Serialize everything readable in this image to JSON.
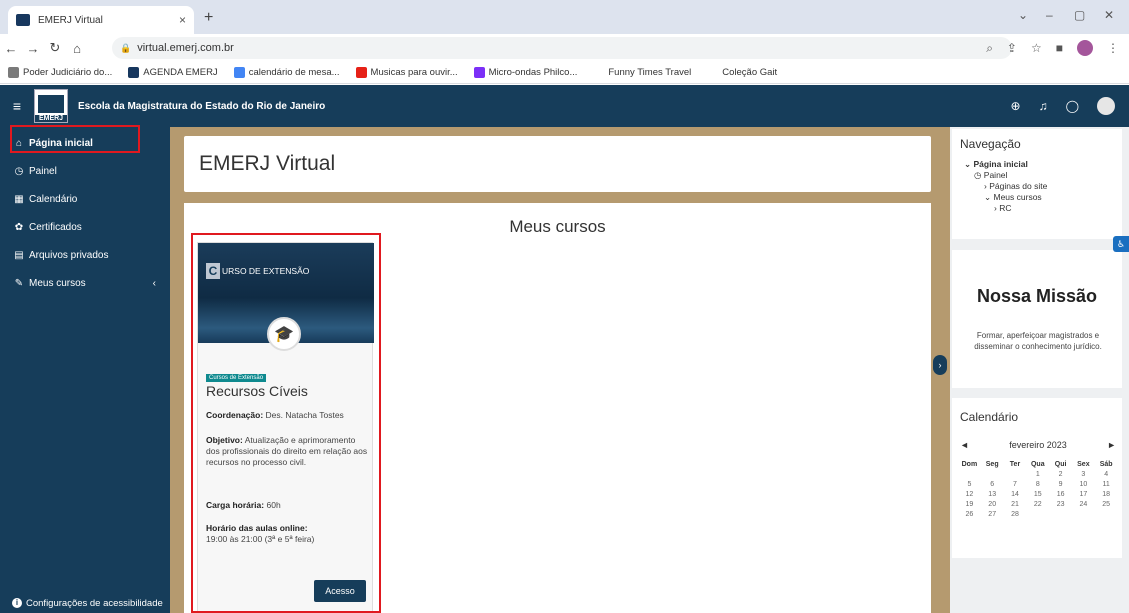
{
  "browser": {
    "tab_title": "EMERJ Virtual",
    "url": "virtual.emerj.com.br",
    "bookmarks": [
      {
        "label": "Poder Judiciário do...",
        "color": "#7a7a7a"
      },
      {
        "label": "AGENDA EMERJ",
        "color": "#17375e"
      },
      {
        "label": "calendário de mesa...",
        "color": "#4285f4"
      },
      {
        "label": "Musicas para ouvir...",
        "color": "#e62117"
      },
      {
        "label": "Micro-ondas Philco...",
        "color": "#7b2ff7"
      },
      {
        "label": "Funny Times Travel",
        "color": "#ffffff"
      },
      {
        "label": "Coleção Gait",
        "color": "#ffffff"
      }
    ]
  },
  "site": {
    "name": "Escola da Magistratura do Estado do Rio de Janeiro",
    "logo_text": "EMERJ"
  },
  "sidebar": {
    "items": [
      {
        "label": "Página inicial",
        "icon": "home-icon"
      },
      {
        "label": "Painel",
        "icon": "gauge-icon"
      },
      {
        "label": "Calendário",
        "icon": "calendar-icon"
      },
      {
        "label": "Certificados",
        "icon": "certificate-icon"
      },
      {
        "label": "Arquivos privados",
        "icon": "files-icon"
      },
      {
        "label": "Meus cursos",
        "icon": "graduation-icon"
      }
    ],
    "accessibility_label": "Configurações de acessibilidade"
  },
  "main": {
    "page_title": "EMERJ Virtual",
    "section_title": "Meus cursos",
    "course": {
      "banner_text": "URSO DE EXTENSÃO",
      "banner_letter": "C",
      "badge": "Cursos de Extensão",
      "title": "Recursos Cíveis",
      "coord_label": "Coordenação:",
      "coord_value": "Des. Natacha Tostes",
      "obj_label": "Objetivo:",
      "obj_value": "Atualização e aprimoramento dos profissionais do direito em relação aos recursos no processo civil.",
      "carga_label": "Carga horária:",
      "carga_value": "60h",
      "horario_label": "Horário das aulas online:",
      "horario_value": "19:00 às 21:00 (3ª e 5ª feira)",
      "button": "Acesso"
    }
  },
  "right": {
    "nav_title": "Navegação",
    "nav_tree": [
      {
        "label": "Página inicial",
        "prefix": "⌄",
        "indent": 0,
        "bold": true
      },
      {
        "label": "Painel",
        "prefix": "◷",
        "indent": 1,
        "bold": false
      },
      {
        "label": "Páginas do site",
        "prefix": "›",
        "indent": 2,
        "bold": false
      },
      {
        "label": "Meus cursos",
        "prefix": "⌄",
        "indent": 2,
        "bold": false
      },
      {
        "label": "RC",
        "prefix": "›",
        "indent": 3,
        "bold": false
      }
    ],
    "mission_title": "Nossa Missão",
    "mission_text": "Formar, aperfeiçoar magistrados e disseminar o conhecimento jurídico.",
    "calendar_title": "Calendário",
    "calendar_month": "fevereiro 2023",
    "calendar_days": [
      "Dom",
      "Seg",
      "Ter",
      "Qua",
      "Qui",
      "Sex",
      "Sáb"
    ],
    "calendar_weeks": [
      [
        "",
        "",
        "",
        "1",
        "2",
        "3",
        "4"
      ],
      [
        "5",
        "6",
        "7",
        "8",
        "9",
        "10",
        "11"
      ],
      [
        "12",
        "13",
        "14",
        "15",
        "16",
        "17",
        "18"
      ],
      [
        "19",
        "20",
        "21",
        "22",
        "23",
        "24",
        "25"
      ],
      [
        "26",
        "27",
        "28",
        "",
        "",
        "",
        ""
      ]
    ]
  }
}
